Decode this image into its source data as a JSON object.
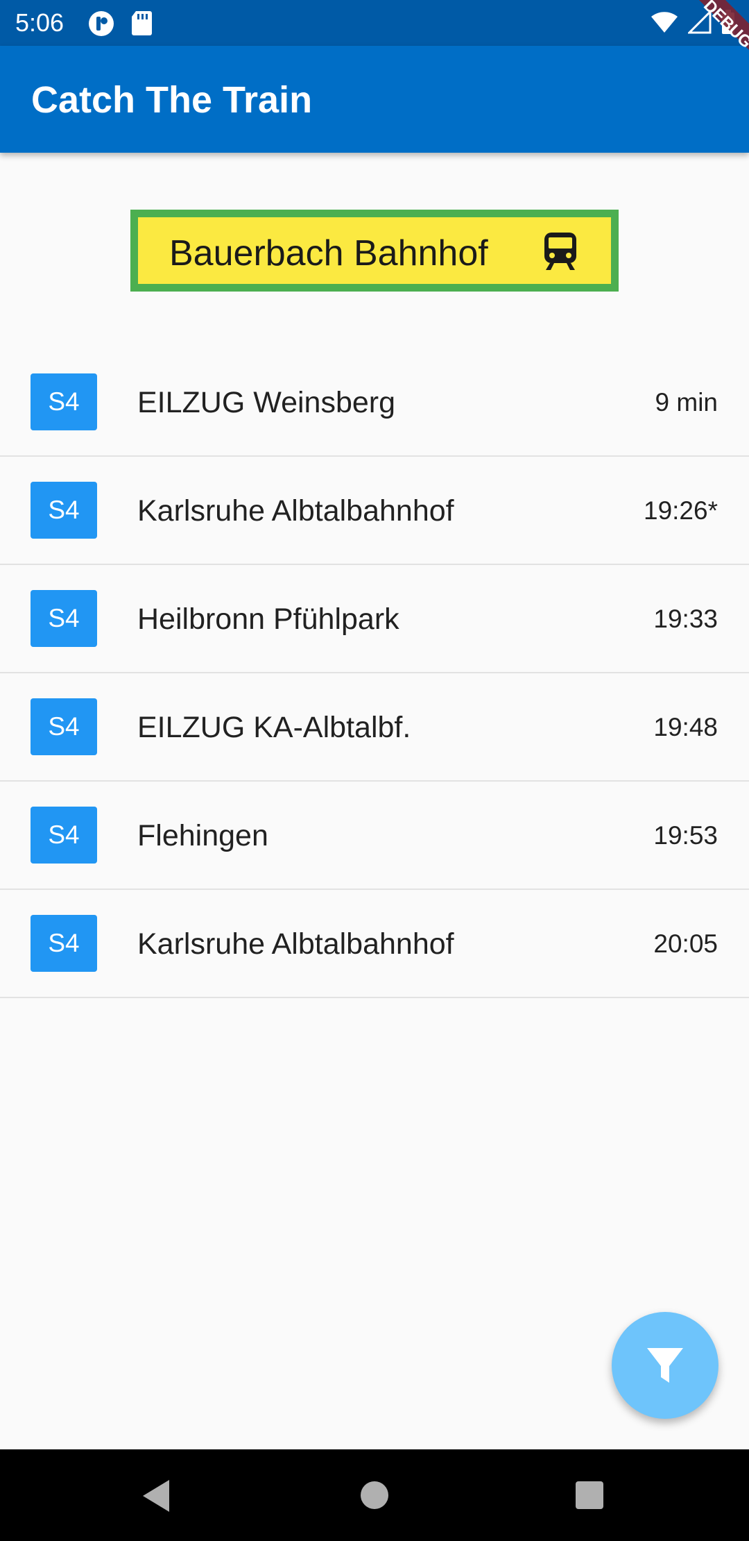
{
  "status_bar": {
    "time": "5:06",
    "icons_left": [
      "media-notification-icon",
      "sd-card-icon"
    ],
    "icons_right": [
      "wifi-icon",
      "cell-signal-icon",
      "battery-icon"
    ]
  },
  "app_bar": {
    "title": "Catch The Train",
    "debug_label": "DEBUG"
  },
  "station": {
    "name": "Bauerbach Bahnhof",
    "icon": "train-icon",
    "colors": {
      "background": "#fbe941",
      "border": "#4caf50"
    }
  },
  "departures": [
    {
      "line": "S4",
      "destination": "EILZUG Weinsberg",
      "time": "9 min"
    },
    {
      "line": "S4",
      "destination": "Karlsruhe Albtalbahnhof",
      "time": "19:26*"
    },
    {
      "line": "S4",
      "destination": "Heilbronn Pfühlpark",
      "time": "19:33"
    },
    {
      "line": "S4",
      "destination": "EILZUG KA-Albtalbf.",
      "time": "19:48"
    },
    {
      "line": "S4",
      "destination": "Flehingen",
      "time": "19:53"
    },
    {
      "line": "S4",
      "destination": "Karlsruhe Albtalbahnhof",
      "time": "20:05"
    }
  ],
  "fab": {
    "icon": "filter-icon"
  },
  "nav_bar": {
    "buttons": [
      "back-icon",
      "home-icon",
      "recents-icon"
    ]
  },
  "colors": {
    "status_bar": "#005aa6",
    "app_bar": "#006ec6",
    "line_badge": "#2196f3",
    "fab": "#6ec4fb",
    "debug_banner": "#7a2434"
  }
}
